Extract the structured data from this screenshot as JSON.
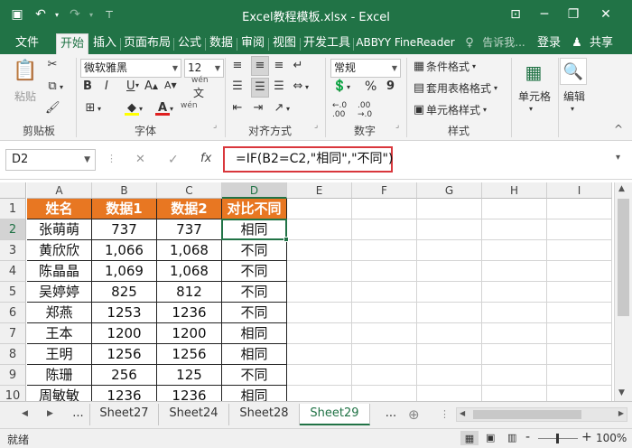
{
  "window": {
    "title": "Excel教程模板.xlsx - Excel",
    "controls": {
      "minimize": "─",
      "restore": "❐",
      "close": "✕",
      "ribbon_display": "⊡"
    }
  },
  "quick_access": {
    "save": "▣",
    "undo": "↶",
    "redo": "↷",
    "customize": "⊤"
  },
  "menu": {
    "tabs": [
      "文件",
      "开始",
      "插入",
      "页面布局",
      "公式",
      "数据",
      "审阅",
      "视图",
      "开发工具",
      "ABBYY FineReader"
    ],
    "active_tab": "开始",
    "tell_me": "告诉我...",
    "login": "登录",
    "share": "共享"
  },
  "ribbon": {
    "clipboard": {
      "paste": "粘贴",
      "label": "剪贴板"
    },
    "font": {
      "name": "微软雅黑",
      "size": "12",
      "bold": "B",
      "italic": "I",
      "underline": "U",
      "wen": "wén",
      "font_color_letter": "A",
      "label": "字体"
    },
    "alignment": {
      "label": "对齐方式"
    },
    "number": {
      "format": "常规",
      "percent": "%",
      "comma": "9",
      "label": "数字"
    },
    "styles": {
      "conditional": "条件格式",
      "table_format": "套用表格格式",
      "cell_style": "单元格样式",
      "label": "样式"
    },
    "cells": {
      "label": "单元格"
    },
    "editing": {
      "label": "编辑"
    }
  },
  "formula_bar": {
    "name_box": "D2",
    "cancel": "✕",
    "enter": "✓",
    "fx": "fx",
    "formula": "=IF(B2=C2,\"相同\",\"不同\")"
  },
  "grid": {
    "columns": [
      "A",
      "B",
      "C",
      "D",
      "E",
      "F",
      "G",
      "H",
      "I"
    ],
    "rows": [
      "1",
      "2",
      "3",
      "4",
      "5",
      "6",
      "7",
      "8",
      "9",
      "10"
    ],
    "header": [
      "姓名",
      "数据1",
      "数据2",
      "对比不同"
    ],
    "data": [
      [
        "张萌萌",
        "737",
        "737",
        "相同"
      ],
      [
        "黄欣欣",
        "1,066",
        "1,068",
        "不同"
      ],
      [
        "陈晶晶",
        "1,069",
        "1,068",
        "不同"
      ],
      [
        "吴婷婷",
        "825",
        "812",
        "不同"
      ],
      [
        "郑燕",
        "1253",
        "1236",
        "不同"
      ],
      [
        "王本",
        "1200",
        "1200",
        "相同"
      ],
      [
        "王明",
        "1256",
        "1256",
        "相同"
      ],
      [
        "陈珊",
        "256",
        "125",
        "不同"
      ],
      [
        "周敏敏",
        "1236",
        "1236",
        "相同"
      ]
    ],
    "selected": "D2",
    "header_color": "#e87722",
    "accent_color": "#217346"
  },
  "sheets": {
    "tabs": [
      "...",
      "Sheet27",
      "Sheet24",
      "Sheet28",
      "Sheet29",
      "..."
    ],
    "active": "Sheet29",
    "add": "⊕"
  },
  "status": {
    "ready": "就绪",
    "zoom": "100%",
    "zoom_minus": "-",
    "zoom_plus": "+"
  }
}
